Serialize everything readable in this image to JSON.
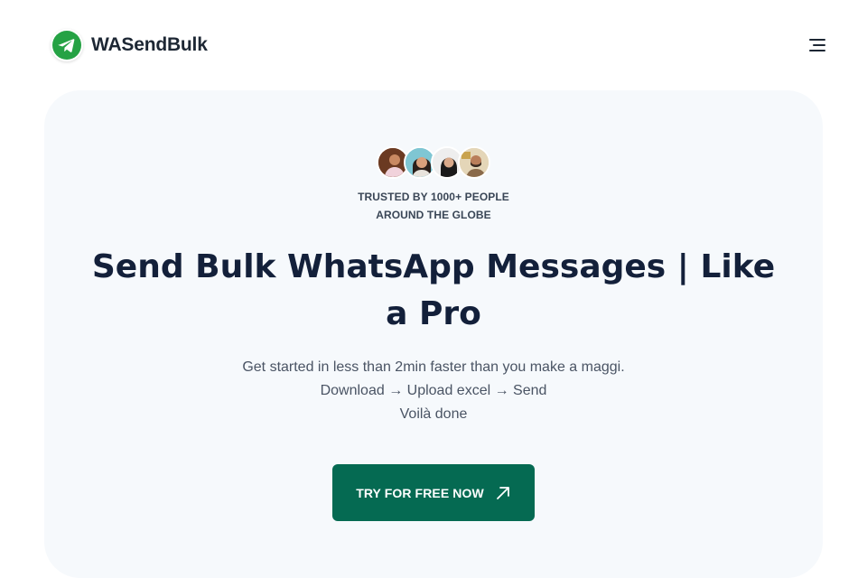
{
  "header": {
    "logo_text": "WASendBulk",
    "logo_icon": "telegram-plane-icon",
    "menu_icon": "hamburger-menu-icon"
  },
  "hero": {
    "avatars": [
      "avatar-1",
      "avatar-2",
      "avatar-3",
      "avatar-4"
    ],
    "trusted_line1": "TRUSTED BY 1000+ PEOPLE",
    "trusted_line2": "AROUND THE GLOBE",
    "headline": "Send Bulk WhatsApp Messages | Like a Pro",
    "sub_line1": "Get started in less than 2min faster than you make a maggi.",
    "sub_line2": "Download → Upload excel → Send",
    "sub_line3": "Voilà done",
    "cta_label": "TRY FOR FREE NOW",
    "cta_icon": "arrow-up-right-icon"
  },
  "colors": {
    "brand_green": "#056a52",
    "logo_green": "#25a244",
    "hero_bg": "#f6f9fc",
    "headline": "#13203a"
  }
}
